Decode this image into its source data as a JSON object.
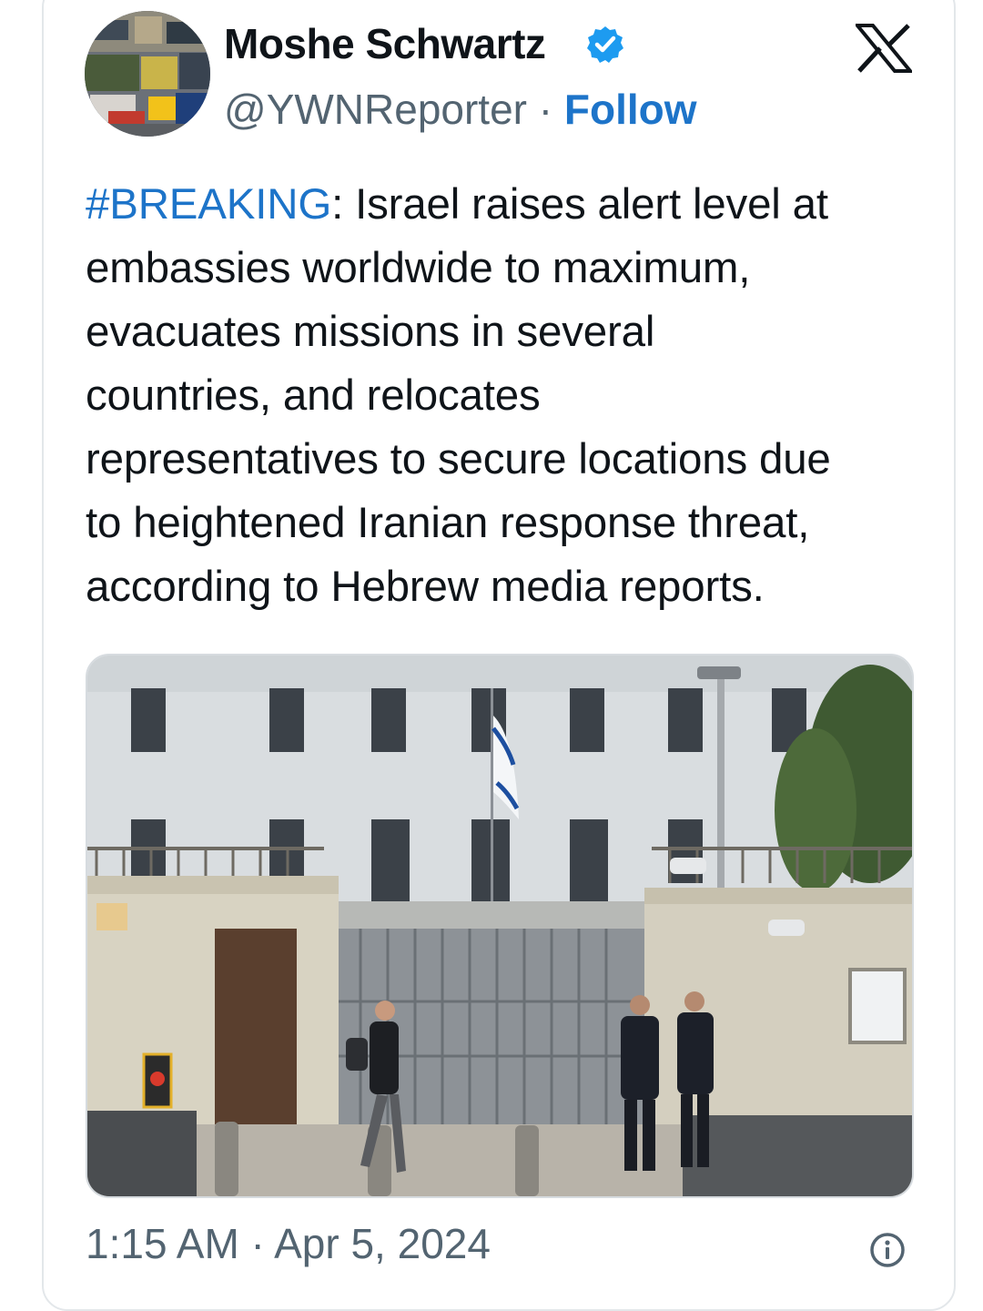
{
  "author": {
    "name": "Moshe Schwartz",
    "handle": "@YWNReporter",
    "separator": "·",
    "follow_label": "Follow",
    "verified_icon": "verified-badge-icon",
    "avatar_icon": "profile-avatar"
  },
  "platform_icon": "x-logo-icon",
  "tweet": {
    "hashtag": "#BREAKING",
    "line1_rest": ": Israel raises alert level at",
    "line2": "embassies worldwide to maximum,",
    "line3": "evacuates missions in several",
    "line4": "countries, and relocates",
    "line5": "representatives to secure locations due",
    "line6": "to heightened Iranian response threat,",
    "line7": "according to Hebrew media reports."
  },
  "media": {
    "kind": "photo",
    "subject": "embassy building with Israeli flag, gate, two guards and a passerby"
  },
  "meta": {
    "timestamp": "1:15 AM · Apr 5, 2024",
    "info_icon": "info-icon"
  },
  "colors": {
    "link_blue": "#1d74c9",
    "secondary_gray": "#536471",
    "text_black": "#0f1419"
  }
}
